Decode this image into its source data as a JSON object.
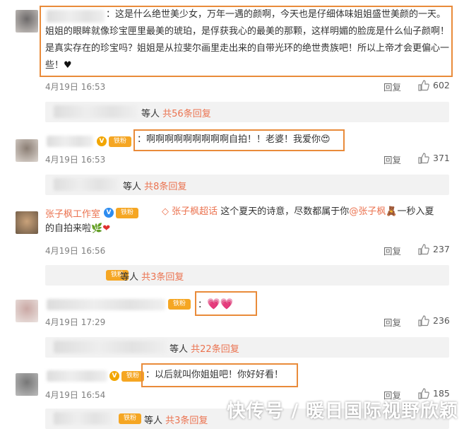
{
  "comments": [
    {
      "text": "：这是什么绝世美少女，万年一遇的颜啊，今天也是仔细体味姐姐盛世美颜的一天。姐姐的眼眸就像珍宝匣里最美的琥珀，是俘获我心的最美的那颗，这样明媚的脸庞是什么仙子颜啊！是真实存在的珍宝吗？姐姐是从拉斐尔画里走出来的自带光环的绝世贵族吧！所以上帝才会更偏心一些！",
      "heart": "♥",
      "time": "4月19日 16:53",
      "reply": "回复",
      "likes": "602",
      "sub_prefix": "等人",
      "sub_count": "共56条回复"
    },
    {
      "text": "：啊啊啊啊啊啊啊啊啊自拍！！老婆！我爱你",
      "emoji": "😍",
      "time": "4月19日 16:53",
      "reply": "回复",
      "likes": "371",
      "sub_prefix": "等人",
      "sub_count": "共8条回复"
    },
    {
      "name": "张子枫工作室",
      "badge": "V",
      "tag": "铁粉",
      "topic": "张子枫超话",
      "text_a": "这个夏天的诗意，尽数都属于你",
      "mention": "@张子枫",
      "text_b": "一秒入夏",
      "text_c": "的自拍来啦",
      "time": "4月19日 16:56",
      "reply": "回复",
      "likes": "237",
      "sub_prefix": "等人",
      "sub_count": "共3条回复"
    },
    {
      "text": "：",
      "tag": "铁粉",
      "time": "4月19日 17:29",
      "reply": "回复",
      "likes": "236",
      "sub_prefix": "等人",
      "sub_count": "共22条回复"
    },
    {
      "text": "：以后就叫你姐姐吧！你好好看！",
      "badge": "V",
      "tag": "铁粉",
      "time": "4月19日 16:54",
      "reply": "回复",
      "likes": "185",
      "sub_prefix": "等人",
      "sub_count": "共3条回复"
    }
  ],
  "watermark": "快传号 / 暖日国际视野欣颖",
  "colors": {
    "accent": "#eb7350",
    "highlight_frame": "#e98b3a",
    "subbox_bg": "#f2f2f2"
  }
}
